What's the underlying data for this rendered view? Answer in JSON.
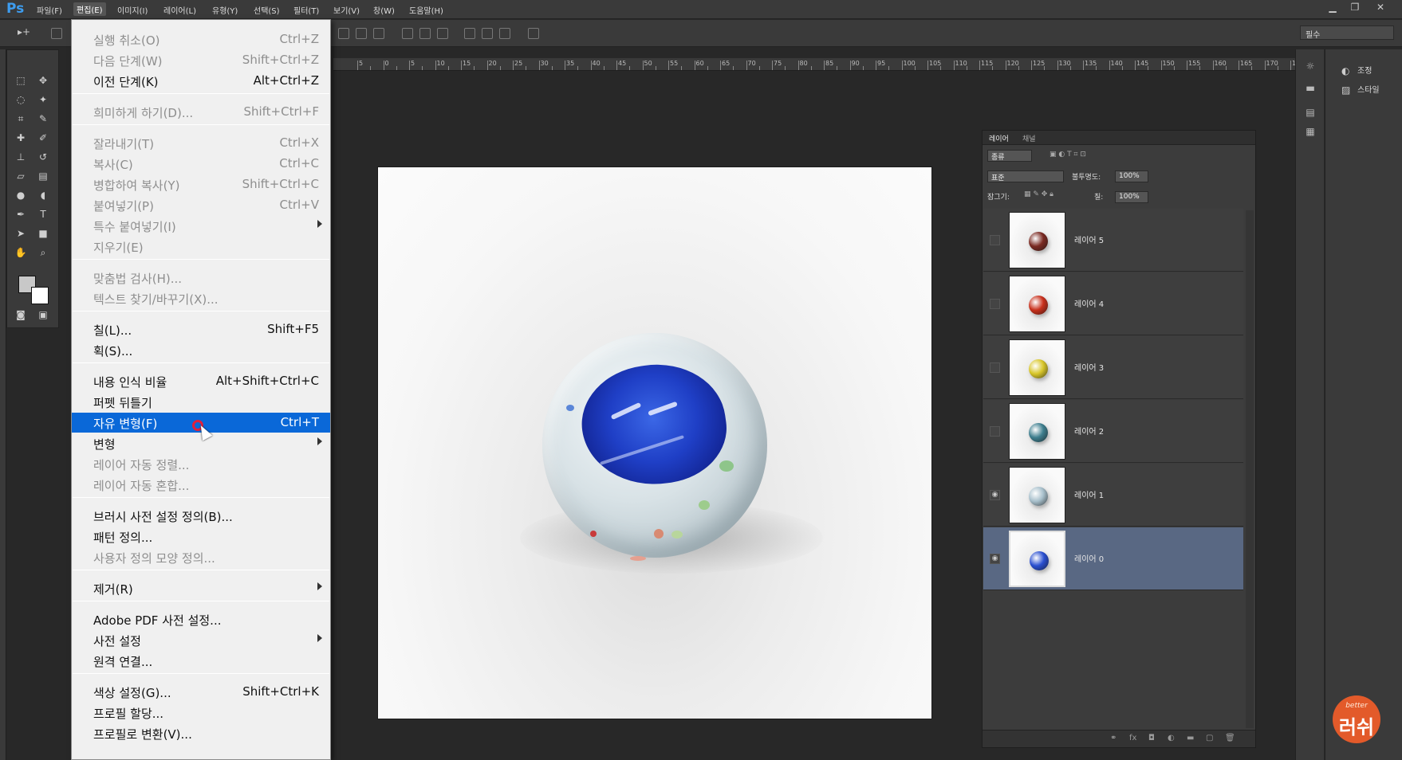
{
  "app": {
    "logo": "Ps",
    "workspace": "필수"
  },
  "menubar": {
    "items": [
      "파일(F)",
      "편집(E)",
      "이미지(I)",
      "레이어(L)",
      "유형(Y)",
      "선택(S)",
      "필터(T)",
      "보기(V)",
      "창(W)",
      "도움말(H)"
    ],
    "active": "편집(E)"
  },
  "window_controls": {
    "minimize": "▁",
    "restore": "❐",
    "close": "✕"
  },
  "ruler": {
    "labels": [
      "5",
      "0",
      "5",
      "10",
      "15",
      "20",
      "25",
      "30",
      "35",
      "40",
      "45",
      "50",
      "55",
      "60",
      "65",
      "70",
      "75",
      "80",
      "85",
      "90",
      "95",
      "100",
      "105",
      "110",
      "115",
      "120",
      "125",
      "130",
      "135",
      "140",
      "145",
      "150",
      "155",
      "160",
      "165",
      "170",
      "17"
    ]
  },
  "edit_menu": {
    "items": [
      {
        "label": "실행 취소(O)",
        "shortcut": "Ctrl+Z",
        "disabled": true
      },
      {
        "label": "다음 단계(W)",
        "shortcut": "Shift+Ctrl+Z",
        "disabled": true
      },
      {
        "label": "이전 단계(K)",
        "shortcut": "Alt+Ctrl+Z",
        "disabled": false
      },
      {
        "label": "희미하게 하기(D)...",
        "shortcut": "Shift+Ctrl+F",
        "disabled": true
      },
      {
        "label": "잘라내기(T)",
        "shortcut": "Ctrl+X",
        "disabled": true
      },
      {
        "label": "복사(C)",
        "shortcut": "Ctrl+C",
        "disabled": true
      },
      {
        "label": "병합하여 복사(Y)",
        "shortcut": "Shift+Ctrl+C",
        "disabled": true
      },
      {
        "label": "붙여넣기(P)",
        "shortcut": "Ctrl+V",
        "disabled": true
      },
      {
        "label": "특수 붙여넣기(I)",
        "shortcut": "",
        "disabled": true,
        "submenu": true
      },
      {
        "label": "지우기(E)",
        "shortcut": "",
        "disabled": true
      },
      {
        "label": "맞춤법 검사(H)...",
        "shortcut": "",
        "disabled": true
      },
      {
        "label": "텍스트 찾기/바꾸기(X)...",
        "shortcut": "",
        "disabled": true
      },
      {
        "label": "칠(L)...",
        "shortcut": "Shift+F5",
        "disabled": false
      },
      {
        "label": "획(S)...",
        "shortcut": "",
        "disabled": false
      },
      {
        "label": "내용 인식 비율",
        "shortcut": "Alt+Shift+Ctrl+C",
        "disabled": false
      },
      {
        "label": "퍼펫 뒤틀기",
        "shortcut": "",
        "disabled": false
      },
      {
        "label": "자유 변형(F)",
        "shortcut": "Ctrl+T",
        "disabled": false,
        "highlighted": true
      },
      {
        "label": "변형",
        "shortcut": "",
        "disabled": false,
        "submenu": true
      },
      {
        "label": "레이어 자동 정렬...",
        "shortcut": "",
        "disabled": true
      },
      {
        "label": "레이어 자동 혼합...",
        "shortcut": "",
        "disabled": true
      },
      {
        "label": "브러시 사전 설정 정의(B)...",
        "shortcut": "",
        "disabled": false
      },
      {
        "label": "패턴 정의...",
        "shortcut": "",
        "disabled": false
      },
      {
        "label": "사용자 정의 모양 정의...",
        "shortcut": "",
        "disabled": true
      },
      {
        "label": "제거(R)",
        "shortcut": "",
        "disabled": false,
        "submenu": true
      },
      {
        "label": "Adobe PDF 사전 설정...",
        "shortcut": "",
        "disabled": false
      },
      {
        "label": "사전 설정",
        "shortcut": "",
        "disabled": false,
        "submenu": true
      },
      {
        "label": "원격 연결...",
        "shortcut": "",
        "disabled": false
      },
      {
        "label": "색상 설정(G)...",
        "shortcut": "Shift+Ctrl+K",
        "disabled": false
      },
      {
        "label": "프로필 할당...",
        "shortcut": "",
        "disabled": false
      },
      {
        "label": "프로필로 변환(V)...",
        "shortcut": "",
        "disabled": false
      }
    ]
  },
  "layers_panel": {
    "tabs": [
      "레이어",
      "채널"
    ],
    "filter_label": "종류",
    "blend_mode": "표준",
    "opacity_label": "불투명도:",
    "opacity": "100%",
    "lock_label": "잠그기:",
    "fill_label": "칠:",
    "fill": "100%",
    "layers": [
      {
        "name": "레이어 5",
        "visible": false,
        "color": "#7a2a22",
        "selected": false
      },
      {
        "name": "레이어 4",
        "visible": false,
        "color": "#c8301c",
        "selected": false
      },
      {
        "name": "레이어 3",
        "visible": false,
        "color": "#d8c62a",
        "selected": false
      },
      {
        "name": "레이어 2",
        "visible": false,
        "color": "#3e7e8e",
        "selected": false
      },
      {
        "name": "레이어 1",
        "visible": true,
        "color": "#a8c0cc",
        "selected": false
      },
      {
        "name": "레이어 0",
        "visible": true,
        "color": "#2a4fd0",
        "selected": true
      }
    ],
    "bottom_icons": [
      "link-icon",
      "fx-icon",
      "mask-icon",
      "adjustment-icon",
      "folder-icon",
      "new-layer-icon",
      "trash-icon"
    ]
  },
  "dock": {
    "entries": [
      "조정",
      "스타일"
    ]
  },
  "watermark": {
    "line1": "better",
    "line2": "러쉬"
  },
  "colors": {
    "highlight": "#0a68d8",
    "selected_layer": "#596883",
    "marble_blue": "#1f3fc6"
  }
}
